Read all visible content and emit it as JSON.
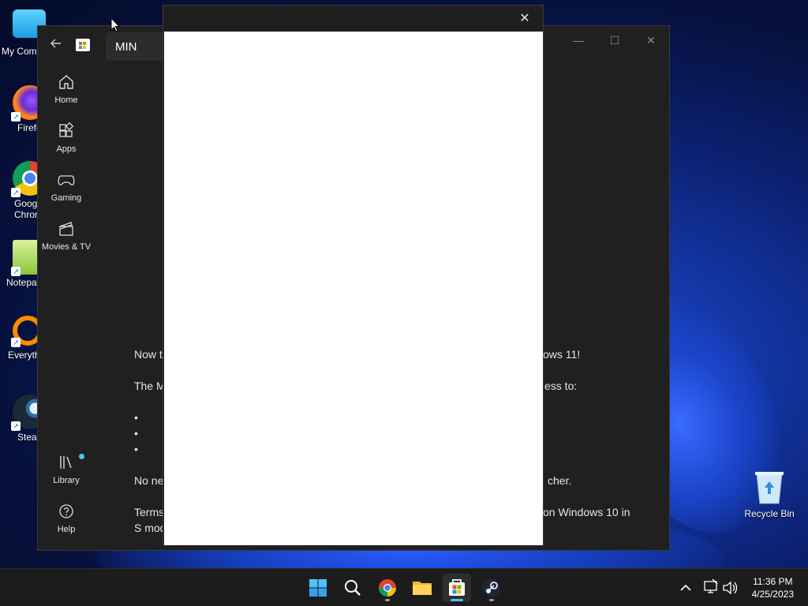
{
  "desktop": {
    "icons": [
      {
        "label": "My Com",
        "name": "my-computer"
      },
      {
        "label": "Firefo",
        "name": "firefox"
      },
      {
        "label": "Goog\nChron",
        "line1": "Goog",
        "line2": "Chron",
        "name": "google-chrome"
      },
      {
        "label": "Notepa",
        "name": "notepad"
      },
      {
        "label": "Everyth",
        "name": "everything"
      },
      {
        "label": "Stear",
        "name": "steam"
      }
    ],
    "recycle_bin": "Recycle Bin"
  },
  "store": {
    "search_value": "MIN",
    "nav": {
      "home": "Home",
      "apps": "Apps",
      "gaming": "Gaming",
      "movies": "Movies & TV",
      "library": "Library",
      "help": "Help"
    },
    "content": {
      "line1_left": "Now t",
      "line1_right": "ows 11!",
      "line2_left": "The M",
      "line2_right": "ess to:",
      "bullets": [
        "•",
        "•",
        "•"
      ],
      "line3_left": "No ne",
      "line3_right": "cher.",
      "line4_left": "Terms",
      "line4_right": "on Windows 10 in",
      "line5_left": "S mod"
    }
  },
  "dialog": {
    "close_glyph": "✕"
  },
  "taskbar": {
    "time": "11:36 PM",
    "date": "4/25/2023"
  },
  "colors": {
    "accent": "#4cc2ff",
    "store_bg": "#202020",
    "taskbar_bg": "#1c1c1c"
  }
}
